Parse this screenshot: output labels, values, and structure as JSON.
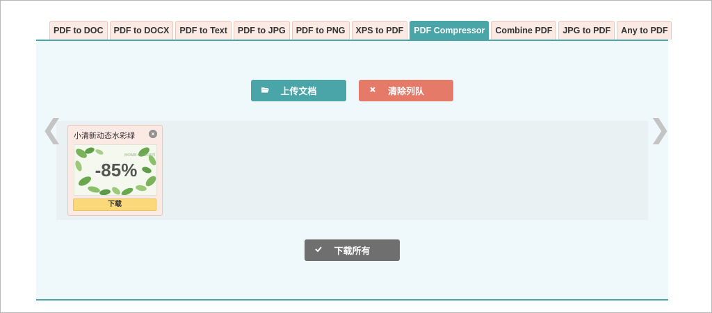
{
  "tabs": [
    {
      "label": "PDF to DOC"
    },
    {
      "label": "PDF to DOCX"
    },
    {
      "label": "PDF to Text"
    },
    {
      "label": "PDF to JPG"
    },
    {
      "label": "PDF to PNG"
    },
    {
      "label": "XPS to PDF"
    },
    {
      "label": "PDF Compressor",
      "active": true
    },
    {
      "label": "Combine PDF"
    },
    {
      "label": "JPG to PDF"
    },
    {
      "label": "Any to PDF"
    }
  ],
  "toolbar": {
    "upload_label": "上传文档",
    "upload_icon": "folder-open-icon",
    "clear_label": "清除列队",
    "clear_icon": "x-icon"
  },
  "queue": {
    "prev_icon": "chevron-left-icon",
    "next_icon": "chevron-right-icon",
    "files": [
      {
        "name": "小清新动态水彩绿",
        "compression": "-85%",
        "thumb_text": "HOME GARDEN",
        "download_label": "下载"
      }
    ]
  },
  "footer": {
    "download_all_label": "下载所有",
    "download_all_icon": "check-icon"
  },
  "colors": {
    "accent": "#49a5a7",
    "danger": "#e57a68",
    "neutral": "#6f6f6f",
    "tab_bg": "#fbe9e4",
    "download_bg": "#f9d97a"
  }
}
